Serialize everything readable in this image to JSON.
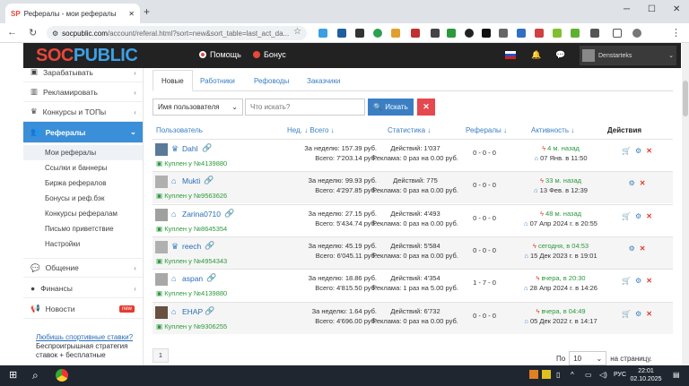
{
  "browser": {
    "tab_title": "Рефералы - мои рефералы",
    "tab_favicon": "SP",
    "url_host": "socpublic.com",
    "url_path": "/account/referal.html?sort=new&sort_table=last_act_da..."
  },
  "site": {
    "logo_a": "SOC",
    "logo_b": "PUBLIC",
    "help_label": "Помощь",
    "bonus_label": "Бонус",
    "username": "Denstarteks"
  },
  "sidebar": {
    "items": [
      {
        "label": "Зарабатывать",
        "icon": "earn-icon"
      },
      {
        "label": "Рекламировать",
        "icon": "chart-icon"
      },
      {
        "label": "Конкурсы и ТОПы",
        "icon": "trophy-icon"
      },
      {
        "label": "Рефералы",
        "icon": "users-icon"
      },
      {
        "label": "Общение",
        "icon": "chat-icon"
      },
      {
        "label": "Финансы",
        "icon": "coins-icon"
      },
      {
        "label": "Новости",
        "icon": "megaphone-icon",
        "badge": "new"
      }
    ],
    "subitems": [
      "Мои рефералы",
      "Ссылки и баннеры",
      "Биржа рефералов",
      "Бонусы и реф.бэк",
      "Конкурсы рефералам",
      "Письмо приветствие",
      "Настройки"
    ],
    "promo_link": "Любишь спортивные ставки?",
    "promo_text": "Беспроигрышная стратегия ставок + бесплатные"
  },
  "tabs": [
    "Новые",
    "Работники",
    "Рефоводы",
    "Заказчики"
  ],
  "search": {
    "filter_value": "Имя пользователя",
    "placeholder": "Что искать?",
    "button_label": "Искать"
  },
  "table": {
    "headers": {
      "user": "Пользователь",
      "week": "Нед.",
      "total": "Всего",
      "stats": "Статистика",
      "refs": "Рефералы",
      "activity": "Активность",
      "actions": "Действия"
    },
    "rows": [
      {
        "name": "Dahl",
        "rank": "crown",
        "buy": "Куплен у №4139880",
        "week": "За неделю: 157.39 руб.",
        "total": "Всего: 7'203.14 руб.",
        "actions_count": "Действий: 1'037",
        "ads": "Реклама: 0 раз на 0.00 руб.",
        "refs": "0 - 0 - 0",
        "last": "4 м. назад",
        "reg": "07 Янв. в 11:50",
        "cart": true,
        "avatar": "#5a7a9a"
      },
      {
        "name": "Mukti",
        "rank": "bank",
        "buy": "Куплен у №9563626",
        "week": "За неделю: 99.93 руб.",
        "total": "Всего: 4'297.85 руб.",
        "actions_count": "Действий: 775",
        "ads": "Реклама: 0 раз на 0.00 руб.",
        "refs": "0 - 0 - 0",
        "last": "33 м. назад",
        "reg": "13 Фев. в 12:39",
        "cart": false,
        "avatar": "#b0b0b0"
      },
      {
        "name": "Zarina0710",
        "rank": "bank",
        "buy": "Куплен у №8645354",
        "week": "За неделю: 27.15 руб.",
        "total": "Всего: 5'434.74 руб.",
        "actions_count": "Действий: 4'493",
        "ads": "Реклама: 0 раз на 0.00 руб.",
        "refs": "0 - 0 - 0",
        "last": "48 м. назад",
        "reg": "07 Апр 2024 г. в 20:55",
        "cart": true,
        "avatar": "#a0a0a0"
      },
      {
        "name": "reech",
        "rank": "crown",
        "buy": "Куплен у №4954343",
        "week": "За неделю: 45.19 руб.",
        "total": "Всего: 6'045.11 руб.",
        "actions_count": "Действий: 5'584",
        "ads": "Реклама: 0 раз на 0.00 руб.",
        "refs": "0 - 0 - 0",
        "last": "сегодня, в 04:53",
        "reg": "15 Дек 2023 г. в 19:01",
        "cart": false,
        "avatar": "#b0b0b0"
      },
      {
        "name": "aspan",
        "rank": "bank",
        "buy": "Куплен у №4139880",
        "week": "За неделю: 18.86 руб.",
        "total": "Всего: 4'815.50 руб.",
        "actions_count": "Действий: 4'354",
        "ads": "Реклама: 1 раз на 5.00 руб.",
        "refs": "1 - 7 - 0",
        "last": "вчера, в 20:30",
        "reg": "28 Апр 2024 г. в 14:26",
        "cart": true,
        "avatar": "#a8a8a8"
      },
      {
        "name": "EHAP",
        "rank": "bank",
        "buy": "Куплен у №9306255",
        "week": "За неделю: 1.64 руб.",
        "total": "Всего: 4'696.00 руб.",
        "actions_count": "Действий: 6'732",
        "ads": "Реклама: 0 раз на 0.00 руб.",
        "refs": "0 - 0 - 0",
        "last": "вчера, в 04:49",
        "reg": "05 Дек 2022 г. в 14:17",
        "cart": true,
        "avatar": "#6a5040"
      }
    ]
  },
  "pagination": {
    "page": "1",
    "per_page_label": "По",
    "per_page_value": "10",
    "per_page_suffix": "на страницу."
  },
  "taskbar": {
    "lang": "РУС",
    "time": "22:01",
    "date": "02.10.2025"
  }
}
